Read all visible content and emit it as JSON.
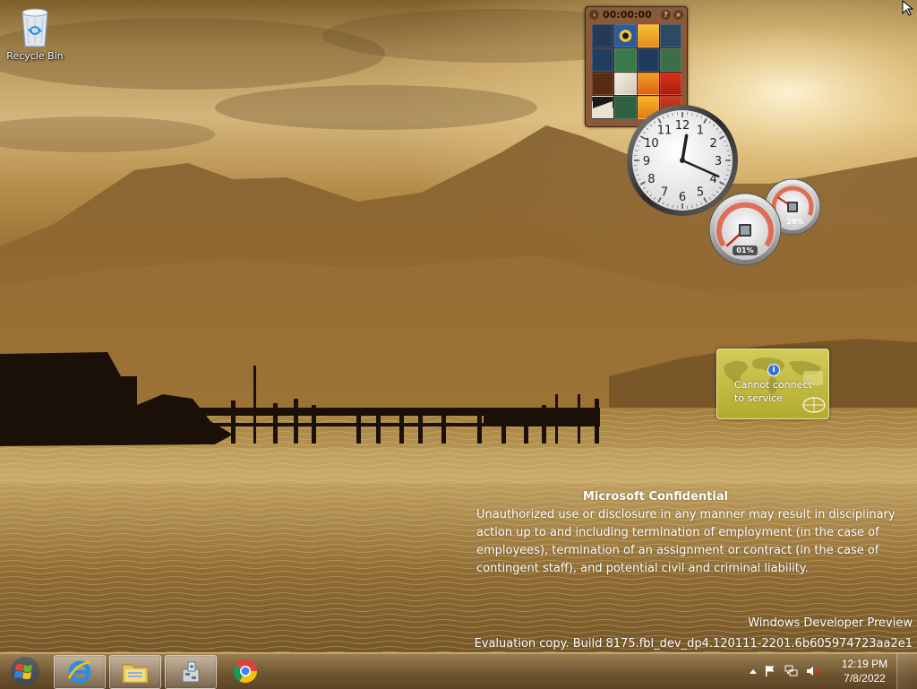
{
  "desktop": {
    "icons": [
      {
        "label": "Recycle Bin",
        "icon": "recycle-bin-icon"
      }
    ]
  },
  "gadgets": {
    "puzzle": {
      "timer": "00:00:00",
      "help": "?",
      "close": "×",
      "prev": "‹"
    },
    "clock": {
      "numbers": [
        "12",
        "1",
        "2",
        "3",
        "4",
        "5",
        "6",
        "7",
        "8",
        "9",
        "10",
        "11"
      ],
      "hour": 12,
      "minute": 19
    },
    "cpu_meter": {
      "cpu_usage": "01%",
      "memory_usage": "29%",
      "cpu_value": 0.01,
      "memory_value": 0.29
    },
    "weather": {
      "message_line1": "Cannot connect",
      "message_line2": "to service",
      "info": "i"
    }
  },
  "watermark": {
    "title": "Microsoft Confidential",
    "body": "Unauthorized use or disclosure in any manner may result in disciplinary action up to and including termination of employment (in the case of employees), termination of an assignment or contract (in the case of contingent staff), and potential civil and criminal liability.",
    "product": "Windows Developer Preview",
    "build": "Evaluation copy. Build 8175.fbl_dev_dp4.120111-2201.6b605974723aa2e1"
  },
  "taskbar": {
    "start_icon": "windows-logo-icon",
    "pinned": [
      {
        "name": "internet-explorer",
        "icon": "internet-explorer-icon"
      },
      {
        "name": "file-explorer",
        "icon": "folder-icon"
      },
      {
        "name": "control-panel",
        "icon": "control-panel-icon"
      },
      {
        "name": "chrome",
        "icon": "chrome-icon"
      }
    ],
    "tray": {
      "icons": [
        "show-hidden-icons-icon",
        "action-center-flag-icon",
        "network-icon",
        "volume-muted-icon"
      ],
      "time": "12:19 PM",
      "date": "7/8/2022"
    }
  },
  "colors": {
    "taskbar": "#6e5330",
    "weather_gadget": "#c2bb3e"
  }
}
